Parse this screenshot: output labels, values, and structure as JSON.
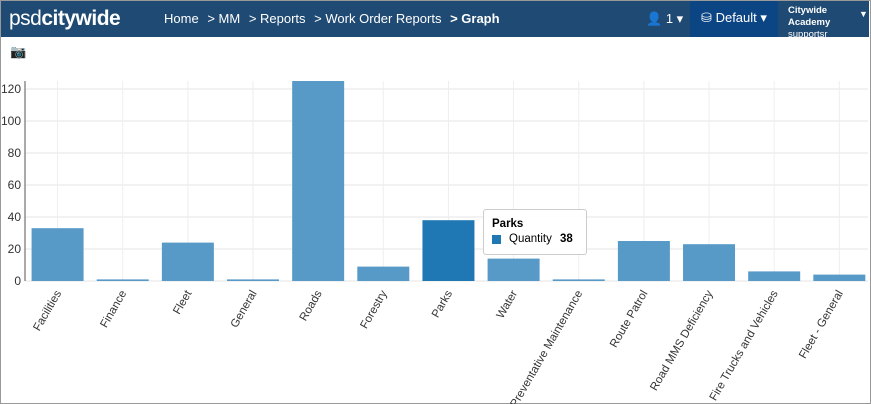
{
  "nav": {
    "logo_light": "psd",
    "logo_bold": "citywide",
    "crumbs": [
      "Home",
      ">  MM",
      ">  Reports",
      ">  Work Order Reports"
    ],
    "current": ">  Graph",
    "user_count": "1",
    "db": "Default",
    "account": "Citywide Academy",
    "username": "supportsr"
  },
  "tooltip": {
    "title": "Parks",
    "series": "Quantity",
    "value": "38"
  },
  "chart_data": {
    "type": "bar",
    "title": "",
    "xlabel": "",
    "ylabel": "",
    "ylim": [
      0,
      125
    ],
    "yticks": [
      0,
      20,
      40,
      60,
      80,
      100,
      120
    ],
    "grid": true,
    "categories": [
      "Facilities",
      "Finance",
      "Fleet",
      "General",
      "Roads",
      "Forestry",
      "Parks",
      "Water",
      "Preventative Maintenance",
      "Route Patrol",
      "Road MMS Deficiency",
      "Fire Trucks and Vehicles",
      "Fleet - General"
    ],
    "series": [
      {
        "name": "Quantity",
        "values": [
          33,
          1,
          24,
          1,
          125,
          9,
          38,
          14,
          1,
          25,
          23,
          6,
          4
        ]
      }
    ],
    "highlight": "Parks",
    "colors": {
      "bar": "#5799c7",
      "highlight": "#1f77b4"
    }
  }
}
